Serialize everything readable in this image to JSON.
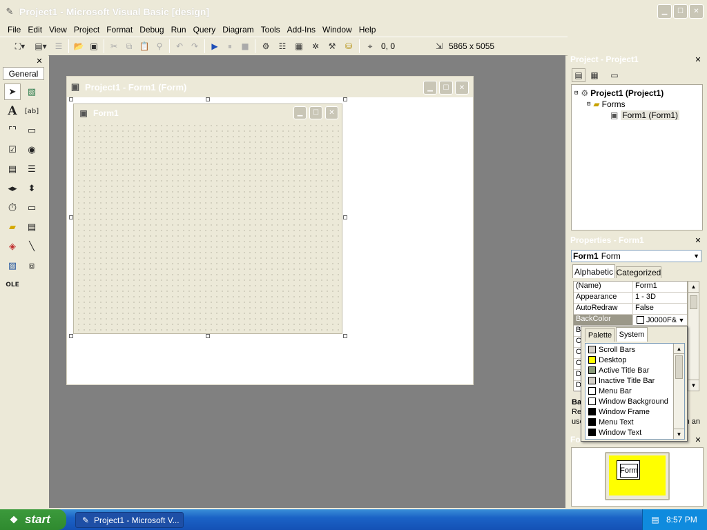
{
  "colors": {
    "titlebar_inactive": "#c9c6b6",
    "accent": "#ffff00",
    "workspace": "#808080"
  },
  "window": {
    "title": "Project1 - Microsoft Visual Basic [design]"
  },
  "menu": {
    "items": [
      "File",
      "Edit",
      "View",
      "Project",
      "Format",
      "Debug",
      "Run",
      "Query",
      "Diagram",
      "Tools",
      "Add-Ins",
      "Window",
      "Help"
    ]
  },
  "toolbar": {
    "position": "0, 0",
    "size": "5865 x 5055"
  },
  "toolbox": {
    "tab": "General"
  },
  "mdi": {
    "title": "Project1 - Form1 (Form)"
  },
  "form": {
    "title": "Form1"
  },
  "project": {
    "title": "Project - Project1",
    "root": "Project1 (Project1)",
    "folder": "Forms",
    "item": "Form1 (Form1)"
  },
  "properties": {
    "title": "Properties - Form1",
    "object_name": "Form1",
    "object_type": "Form",
    "tab_alpha": "Alphabetic",
    "tab_cat": "Categorized",
    "rows": [
      {
        "name": "(Name)",
        "value": "Form1"
      },
      {
        "name": "Appearance",
        "value": "1 - 3D"
      },
      {
        "name": "AutoRedraw",
        "value": "False"
      },
      {
        "name": "BackColor",
        "value": "J0000F&"
      }
    ],
    "partial_rows": [
      "Bo",
      "C",
      "C",
      "C",
      "Di",
      "Di"
    ],
    "desc_title": "Ba",
    "desc_line1": "Re",
    "desc_line2": "use",
    "desc_tail": "n an"
  },
  "color_dropdown": {
    "tab_palette": "Palette",
    "tab_system": "System",
    "items": [
      {
        "label": "Scroll Bars",
        "color": "#d4d0c8"
      },
      {
        "label": "Desktop",
        "color": "#ffff00"
      },
      {
        "label": "Active Title Bar",
        "color": "#8a9a7a"
      },
      {
        "label": "Inactive Title Bar",
        "color": "#d4d0c8"
      },
      {
        "label": "Menu Bar",
        "color": "#ffffff"
      },
      {
        "label": "Window Background",
        "color": "#ffffff"
      },
      {
        "label": "Window Frame",
        "color": "#000000"
      },
      {
        "label": "Menu Text",
        "color": "#000000"
      },
      {
        "label": "Window Text",
        "color": "#000000"
      }
    ]
  },
  "layout_window": {
    "title": "Fo",
    "form_label": "Form"
  },
  "taskbar": {
    "start": "start",
    "task": "Project1 - Microsoft V...",
    "time": "8:57 PM"
  }
}
